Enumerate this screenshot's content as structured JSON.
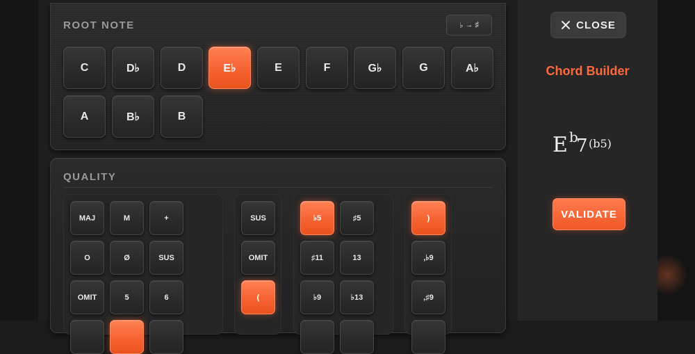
{
  "root_note": {
    "title": "ROOT NOTE",
    "flip_button": {
      "from": "♭",
      "arrow": "→",
      "to": "♯"
    },
    "notes": [
      "C",
      "D♭",
      "D",
      "E♭",
      "E",
      "F",
      "G♭",
      "G",
      "A♭",
      "A",
      "B♭",
      "B"
    ],
    "selected": "E♭"
  },
  "quality": {
    "title": "QUALITY",
    "groups": [
      {
        "keys": [
          "MAJ",
          "M",
          "+",
          "O",
          "Ø",
          "SUS",
          "OMIT",
          "5",
          "6"
        ],
        "selected": []
      },
      {
        "keys": [
          "SUS",
          "OMIT",
          "("
        ],
        "selected": [
          "("
        ]
      },
      {
        "keys": [
          "♭5",
          "♯5",
          "♯11",
          "13",
          "♭9",
          "♭13"
        ],
        "selected": [
          "♭5"
        ]
      },
      {
        "keys": [
          ")",
          ",♭9",
          ",♯9"
        ],
        "selected": [
          ")"
        ]
      }
    ]
  },
  "sidebar": {
    "close_label": "CLOSE",
    "title": "Chord Builder",
    "chord": {
      "root": "E",
      "accidental": "b",
      "seven": "7",
      "extension": "(b5)"
    },
    "validate_label": "VALIDATE"
  },
  "colors": {
    "accent": "#f5602f",
    "title_accent": "#ff6a3c",
    "key_bg": "#2b2b2b"
  },
  "icons": {
    "close": "close-icon",
    "flip": "flat-to-sharp-icon"
  }
}
